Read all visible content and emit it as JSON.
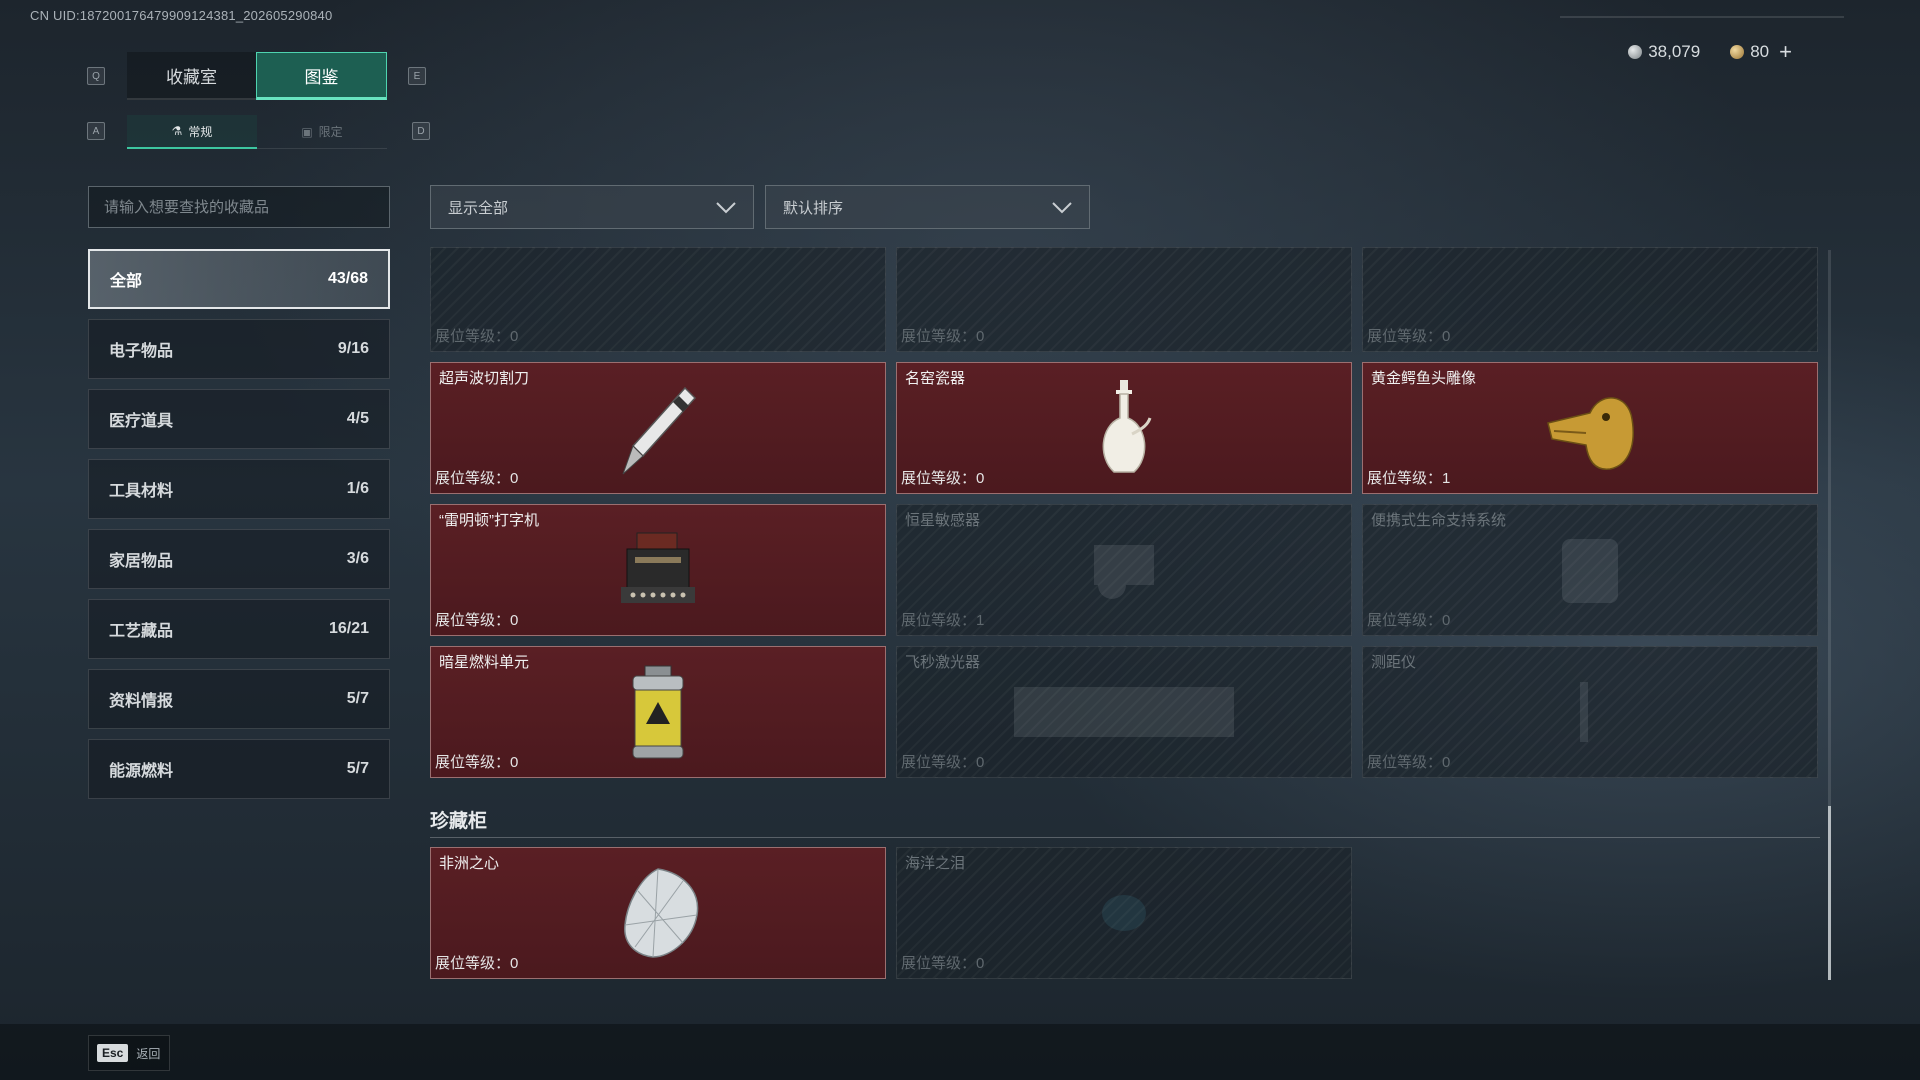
{
  "uid": "CN UID:18720017647990912438​1_202605290840",
  "currency": {
    "silver": "38,079",
    "gold": "80",
    "plus": "+"
  },
  "keys": {
    "q": "Q",
    "e": "E",
    "a": "A",
    "d": "D"
  },
  "main_tabs": [
    "收藏室",
    "图鉴"
  ],
  "sub_tabs": [
    "常规",
    "限定"
  ],
  "search": {
    "placeholder": "请输入想要查找的收藏品"
  },
  "categories": [
    {
      "label": "全部",
      "count": "43/68"
    },
    {
      "label": "电子物品",
      "count": "9/16"
    },
    {
      "label": "医疗道具",
      "count": "4/5"
    },
    {
      "label": "工具材料",
      "count": "1/6"
    },
    {
      "label": "家居物品",
      "count": "3/6"
    },
    {
      "label": "工艺藏品",
      "count": "16/21"
    },
    {
      "label": "资料情报",
      "count": "5/7"
    },
    {
      "label": "能源燃料",
      "count": "5/7"
    }
  ],
  "filters": {
    "show": "显示全部",
    "sort": "默认排序"
  },
  "level_label": "展位等级：",
  "items": [
    {
      "name": "",
      "level": "0",
      "unlocked": false,
      "icon": "faded-object-icon"
    },
    {
      "name": "",
      "level": "0",
      "unlocked": false,
      "icon": "faded-object-icon"
    },
    {
      "name": "",
      "level": "0",
      "unlocked": false,
      "icon": "faded-object-icon"
    },
    {
      "name": "超声波切割刀",
      "level": "0",
      "unlocked": true,
      "icon": "ultrasonic-cutter-icon"
    },
    {
      "name": "名窑瓷器",
      "level": "0",
      "unlocked": true,
      "icon": "porcelain-vase-icon"
    },
    {
      "name": "黄金鳄鱼头雕像",
      "level": "1",
      "unlocked": true,
      "icon": "golden-crocodile-head-icon"
    },
    {
      "name": "“雷明顿”打字机",
      "level": "0",
      "unlocked": true,
      "icon": "typewriter-icon"
    },
    {
      "name": "恒星敏感器",
      "level": "1",
      "unlocked": false,
      "icon": "star-sensor-icon"
    },
    {
      "name": "便携式生命支持系统",
      "level": "0",
      "unlocked": false,
      "icon": "life-support-icon"
    },
    {
      "name": "暗星燃料单元",
      "level": "0",
      "unlocked": true,
      "icon": "fuel-canister-icon"
    },
    {
      "name": "飞秒激光器",
      "level": "0",
      "unlocked": false,
      "icon": "laser-device-icon"
    },
    {
      "name": "测距仪",
      "level": "0",
      "unlocked": false,
      "icon": "rangefinder-icon"
    }
  ],
  "section_title": "珍藏柜",
  "vault_items": [
    {
      "name": "非洲之心",
      "level": "0",
      "unlocked": true,
      "icon": "diamond-icon"
    },
    {
      "name": "海洋之泪",
      "level": "0",
      "unlocked": false,
      "icon": "gem-icon"
    }
  ],
  "back": {
    "key": "Esc",
    "label": "返回"
  },
  "colors": {
    "accent": "#3dc6a0",
    "unlocked_card": "#5a1f24",
    "locked_card": "#1c242b"
  }
}
